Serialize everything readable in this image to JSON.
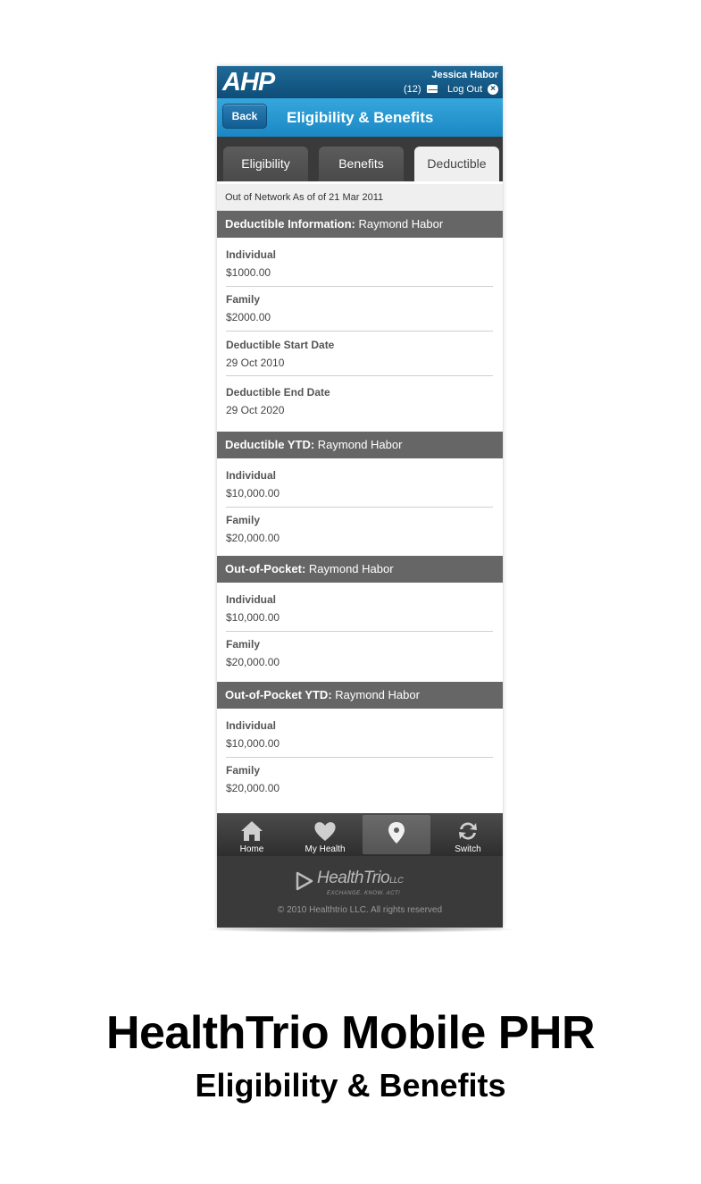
{
  "header": {
    "logo": "AHP",
    "user_name": "Jessica Habor",
    "message_count": "(12)",
    "logout_label": "Log Out"
  },
  "titlebar": {
    "back_label": "Back",
    "title": "Eligibility & Benefits"
  },
  "tabs": [
    {
      "label": "Eligibility",
      "active": false
    },
    {
      "label": "Benefits",
      "active": false
    },
    {
      "label": "Deductible",
      "active": true
    }
  ],
  "as_of": "Out of Network As of of 21 Mar 2011",
  "sections": [
    {
      "title": "Deductible Information:",
      "member": "Raymond Habor",
      "fields": [
        {
          "label": "Individual",
          "value": "$1000.00"
        },
        {
          "label": "Family",
          "value": "$2000.00"
        },
        {
          "label": "Deductible Start Date",
          "value": "29 Oct 2010"
        },
        {
          "label": "Deductible End Date",
          "value": "29 Oct 2020"
        }
      ]
    },
    {
      "title": "Deductible YTD:",
      "member": "Raymond Habor",
      "fields": [
        {
          "label": "Individual",
          "value": "$10,000.00"
        },
        {
          "label": "Family",
          "value": "$20,000.00"
        }
      ]
    },
    {
      "title": "Out-of-Pocket:",
      "member": "Raymond Habor",
      "fields": [
        {
          "label": "Individual",
          "value": "$10,000.00"
        },
        {
          "label": "Family",
          "value": "$20,000.00"
        }
      ]
    },
    {
      "title": "Out-of-Pocket YTD:",
      "member": "Raymond Habor",
      "fields": [
        {
          "label": "Individual",
          "value": "$10,000.00"
        },
        {
          "label": "Family",
          "value": "$20,000.00"
        }
      ]
    }
  ],
  "nav": [
    {
      "label": "Home",
      "icon": "home-icon"
    },
    {
      "label": "My Health",
      "icon": "heart-icon"
    },
    {
      "label": "",
      "icon": "location-pin-icon",
      "active": true
    },
    {
      "label": "Switch",
      "icon": "switch-icon"
    }
  ],
  "footer": {
    "logo_text": "HealthTrio",
    "logo_suffix": "LLC",
    "tagline": "EXCHANGE. KNOW. ACT!",
    "copyright": "© 2010 Healthtrio LLC. All rights reserved"
  },
  "caption": {
    "title": "HealthTrio Mobile PHR",
    "subtitle": "Eligibility & Benefits"
  },
  "colors": {
    "header_blue": "#0e4d78",
    "title_blue": "#1b87c4",
    "section_gray": "#666666",
    "nav_dark": "#3a3a3a"
  }
}
